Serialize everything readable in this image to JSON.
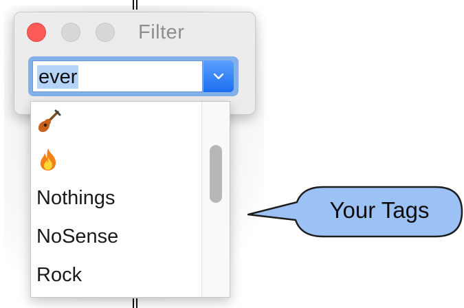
{
  "window": {
    "title": "Filter"
  },
  "combo": {
    "value": "ever"
  },
  "dropdown": {
    "items": [
      {
        "kind": "emoji",
        "icon": "guitar-icon"
      },
      {
        "kind": "emoji",
        "icon": "fire-icon"
      },
      {
        "kind": "text",
        "label": "Nothings"
      },
      {
        "kind": "text",
        "label": "NoSense"
      },
      {
        "kind": "text",
        "label": "Rock"
      }
    ]
  },
  "callout": {
    "label": "Your Tags"
  },
  "colors": {
    "close_button": "#fc5b57",
    "accent_blue": "#1b6ff0",
    "selection": "#b5d3f7",
    "callout_fill": "#9cc2f5"
  }
}
